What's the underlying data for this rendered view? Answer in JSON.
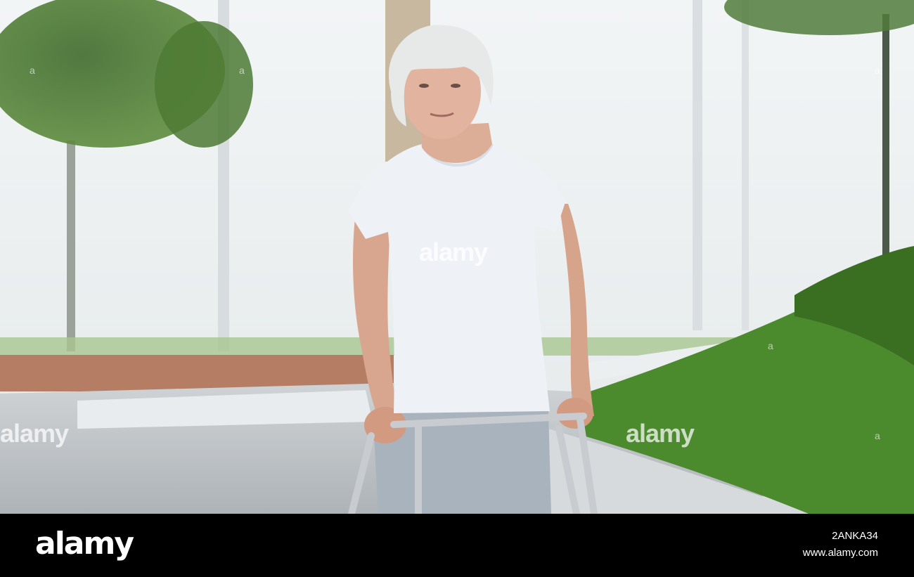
{
  "photo": {
    "alt_subject": "elderly woman with walker",
    "watermarks": [
      "alamy",
      "alamy",
      "alamy",
      "a",
      "a",
      "a",
      "a",
      "a"
    ]
  },
  "footer": {
    "brand": "alamy",
    "image_id": "2ANKA34",
    "url": "www.alamy.com"
  },
  "colors": {
    "bar": "#000000",
    "shirt": "#eef2f6",
    "pants": "#a9b3be",
    "grass": "#4c8a2e",
    "walker": "#c8ccd0"
  }
}
